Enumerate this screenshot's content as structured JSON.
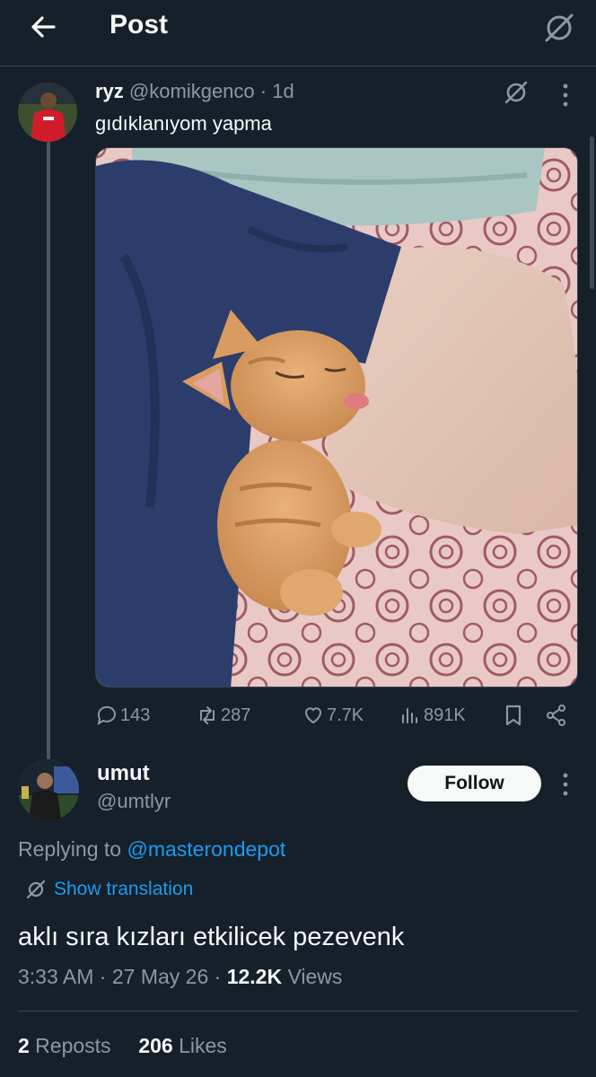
{
  "header": {
    "title": "Post",
    "back_icon": "arrow-left-icon",
    "grok_icon": "grok-icon"
  },
  "post": {
    "name": "ryz",
    "handle": "@komikgenco",
    "separator": "·",
    "age": "1d",
    "text": "gıdıklanıyom yapma",
    "media": "photo: orange kitten licking an arm on a patterned bedsheet",
    "actions": {
      "replies": "143",
      "reposts": "287",
      "likes": "7.7K",
      "views": "891K"
    }
  },
  "reply": {
    "name": "umut",
    "handle": "@umtlyr",
    "follow_label": "Follow",
    "replying_prefix": "Replying to ",
    "replying_handle": "@masterondepot",
    "show_translation": "Show translation",
    "text": "aklı sıra kızları etkilicek pezevenk",
    "time": "3:33 AM",
    "dot": "·",
    "date": "27 May 26",
    "views_count": "12.2K",
    "views_label": " Views",
    "reposts_count": "2",
    "reposts_label": " Reposts",
    "likes_count": "206",
    "likes_label": " Likes"
  },
  "colors": {
    "background": "#15202b",
    "text": "#f7f9f9",
    "muted": "#8b98a5",
    "link": "#1d9bf0",
    "border": "#38444d"
  }
}
